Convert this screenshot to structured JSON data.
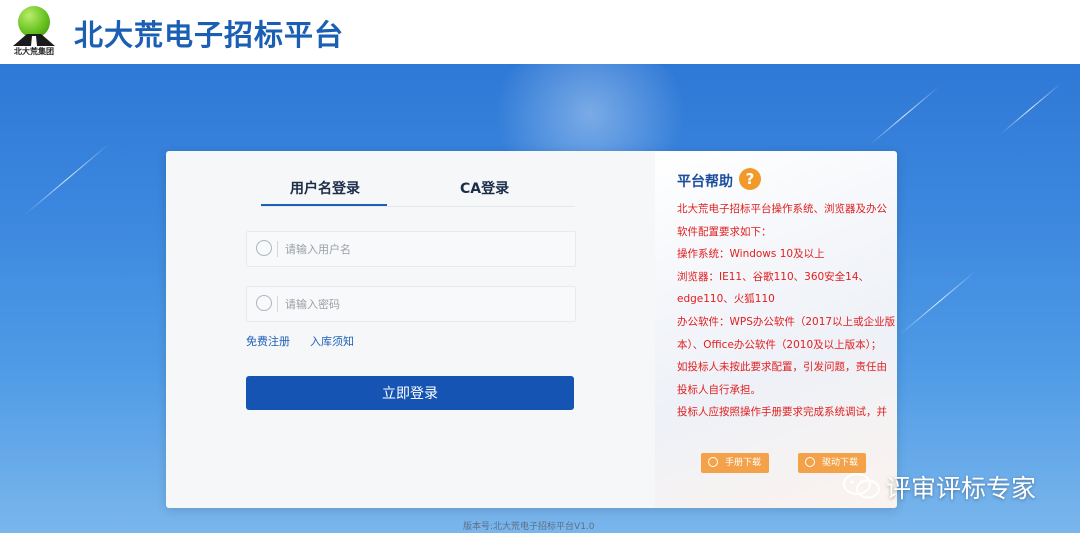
{
  "header": {
    "logo_text": "北大荒集团",
    "title": "北大荒电子招标平台"
  },
  "login": {
    "tabs": [
      "用户名登录",
      "CA登录"
    ],
    "username_placeholder": "请输入用户名",
    "password_placeholder": "请输入密码",
    "register_link": "免费注册",
    "notice_link": "入库须知",
    "submit_label": "立即登录"
  },
  "help": {
    "title": "平台帮助",
    "lines": [
      "北大荒电子招标平台操作系统、浏览器及办公",
      "软件配置要求如下：",
      "操作系统：Windows 10及以上",
      "浏览器：IE11、谷歌110、360安全14、",
      "edge110、火狐110",
      "办公软件：WPS办公软件（2017以上或企业版",
      "本）、Office办公软件（2010及以上版本）；",
      "如投标人未按此要求配置，引发问题，责任由",
      "投标人自行承担。",
      "投标人应按照操作手册要求完成系统调试，并"
    ],
    "manual_button": "手册下载",
    "driver_button": "驱动下载"
  },
  "footer": {
    "version": "版本号:北大荒电子招标平台V1.0"
  },
  "watermark": {
    "text": "评审评标专家"
  },
  "colors": {
    "brand_blue": "#1554b3",
    "help_red": "#e02020",
    "accent_orange": "#f3a24a"
  }
}
